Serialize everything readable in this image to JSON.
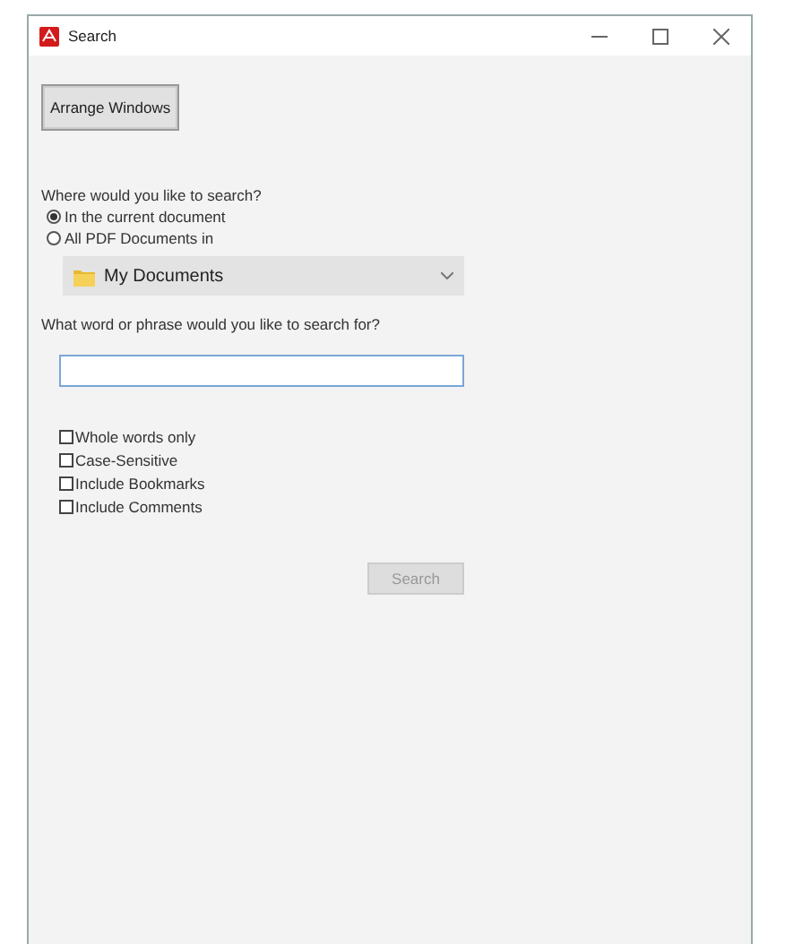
{
  "window": {
    "title": "Search"
  },
  "arrange_button": {
    "label": "Arrange Windows"
  },
  "scope": {
    "question": "Where would you like to search?",
    "options": [
      {
        "label": "In the current document",
        "selected": true
      },
      {
        "label": "All PDF Documents in",
        "selected": false
      }
    ],
    "folder": {
      "value": "My Documents"
    }
  },
  "query": {
    "question": "What word or phrase would you like to search for?"
  },
  "options": [
    {
      "label": "Whole words only",
      "checked": false
    },
    {
      "label": "Case-Sensitive",
      "checked": false
    },
    {
      "label": "Include Bookmarks",
      "checked": false
    },
    {
      "label": "Include Comments",
      "checked": false
    }
  ],
  "search_button": {
    "label": "Search",
    "disabled": true
  }
}
